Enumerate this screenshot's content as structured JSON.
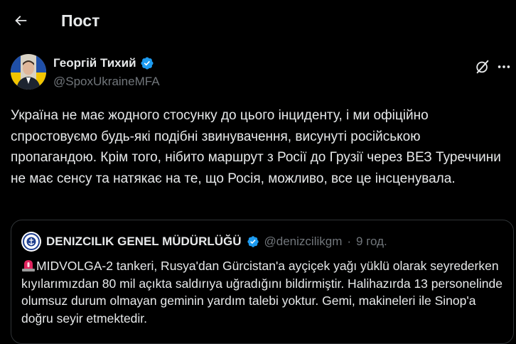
{
  "header": {
    "title": "Пост",
    "back_icon": "arrow-left-icon"
  },
  "post": {
    "author_name": "Георгій Тихий",
    "author_handle": "@SpoxUkraineMFA",
    "verified": true,
    "text": "Україна не має жодного стосунку до цього інциденту, і ми офіційно спростовуємо будь-які подібні звинувачення, висунуті російською пропагандою. Крім того, нібито маршрут з Росії до Грузії через ВЕЗ Туреччини не має сенсу та натякає на те, що Росія, можливо, все це інсценувала."
  },
  "quote": {
    "author_name": "DENIZCILIK GENEL MÜDÜRLÜĞÜ",
    "author_handle": "@denizcilikgm",
    "separator": "·",
    "time": "9 год.",
    "emoji_icon": "rotating-light-icon",
    "text": "MIDVOLGA-2 tankeri, Rusya'dan Gürcistan'a ayçiçek yağı yüklü olarak seyrederken kıyılarımızdan 80 mil açıkta saldırıya uğradığını bildirmiştir. Halihazırda 13 personelinde olumsuz durum olmayan geminin yardım talebi yoktur. Gemi, makineleri ile Sinop'a doğru seyir etmektedir."
  },
  "colors": {
    "background": "#000000",
    "text_primary": "#e7e9ea",
    "text_secondary": "#71767b",
    "border": "#2f3336",
    "verified_blue": "#1d9bf0"
  }
}
